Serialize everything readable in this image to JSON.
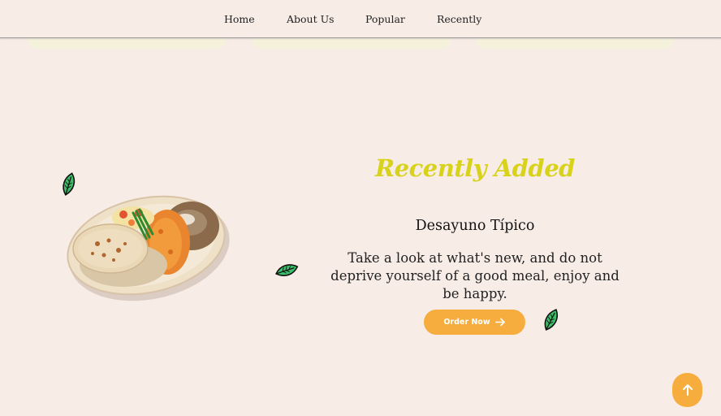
{
  "nav": {
    "items": [
      {
        "label": "Home"
      },
      {
        "label": "About Us"
      },
      {
        "label": "Popular"
      },
      {
        "label": "Recently"
      }
    ]
  },
  "recent": {
    "title": "Recently Added",
    "dish_name": "Desayuno Típico",
    "description": "Take a look at what's new, and do not deprive yourself of a good meal, enjoy and be happy.",
    "order_label": "Order Now"
  },
  "colors": {
    "background": "#f7ece6",
    "accent": "#f6ad3d",
    "title": "#d8d21a",
    "leaf": "#3dbf6a"
  },
  "icons": {
    "order_arrow": "arrow-right-icon",
    "scroll_top": "arrow-up-icon",
    "leaf": "leaf-icon"
  }
}
